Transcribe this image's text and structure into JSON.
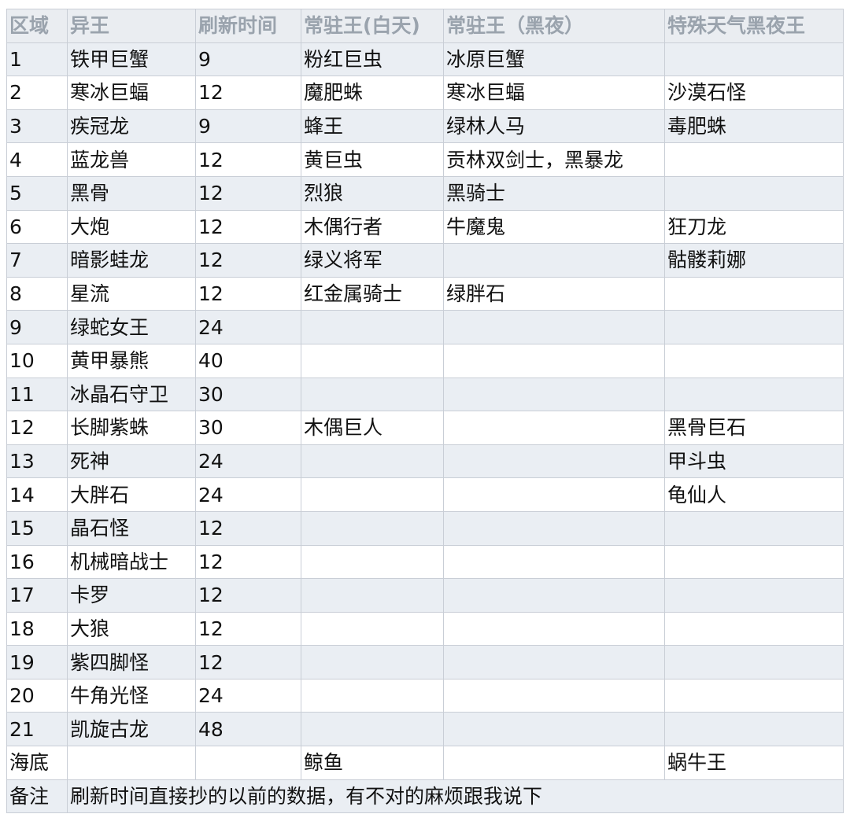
{
  "table": {
    "headers": [
      "区域",
      "异王",
      "刷新时间",
      "常驻王(白天)",
      "常驻王（黑夜）",
      "特殊天气黑夜王"
    ],
    "rows": [
      [
        "1",
        "铁甲巨蟹",
        "9",
        "粉红巨虫",
        "冰原巨蟹",
        ""
      ],
      [
        "2",
        "寒冰巨蝠",
        "12",
        "魔肥蛛",
        "寒冰巨蝠",
        "沙漠石怪"
      ],
      [
        "3",
        "疾冠龙",
        "9",
        "蜂王",
        "绿林人马",
        "毒肥蛛"
      ],
      [
        "4",
        "蓝龙兽",
        "12",
        "黄巨虫",
        "贡林双剑士，黑暴龙",
        ""
      ],
      [
        "5",
        "黑骨",
        "12",
        "烈狼",
        "黑骑士",
        ""
      ],
      [
        "6",
        "大炮",
        "12",
        "木偶行者",
        "牛魔鬼",
        "狂刀龙"
      ],
      [
        "7",
        "暗影蛙龙",
        "12",
        "绿义将军",
        "",
        "骷髅莉娜"
      ],
      [
        "8",
        "星流",
        "12",
        "红金属骑士",
        "绿胖石",
        ""
      ],
      [
        "9",
        "绿蛇女王",
        "24",
        "",
        "",
        ""
      ],
      [
        "10",
        "黄甲暴熊",
        "40",
        "",
        "",
        ""
      ],
      [
        "11",
        "冰晶石守卫",
        "30",
        "",
        "",
        ""
      ],
      [
        "12",
        "长脚紫蛛",
        "30",
        "木偶巨人",
        "",
        "黑骨巨石"
      ],
      [
        "13",
        "死神",
        "24",
        "",
        "",
        "甲斗虫"
      ],
      [
        "14",
        "大胖石",
        "24",
        "",
        "",
        "龟仙人"
      ],
      [
        "15",
        "晶石怪",
        "12",
        "",
        "",
        ""
      ],
      [
        "16",
        "机械暗战士",
        "12",
        "",
        "",
        ""
      ],
      [
        "17",
        "卡罗",
        "12",
        "",
        "",
        ""
      ],
      [
        "18",
        "大狼",
        "12",
        "",
        "",
        ""
      ],
      [
        "19",
        "紫四脚怪",
        "12",
        "",
        "",
        ""
      ],
      [
        "20",
        "牛角光怪",
        "24",
        "",
        "",
        ""
      ],
      [
        "21",
        "凯旋古龙",
        "48",
        "",
        "",
        ""
      ],
      [
        "海底",
        "",
        "",
        "鲸鱼",
        "",
        "蜗牛王"
      ]
    ],
    "note": {
      "label": "备注",
      "text": "刷新时间直接抄的以前的数据，有不对的麻烦跟我说下"
    }
  }
}
